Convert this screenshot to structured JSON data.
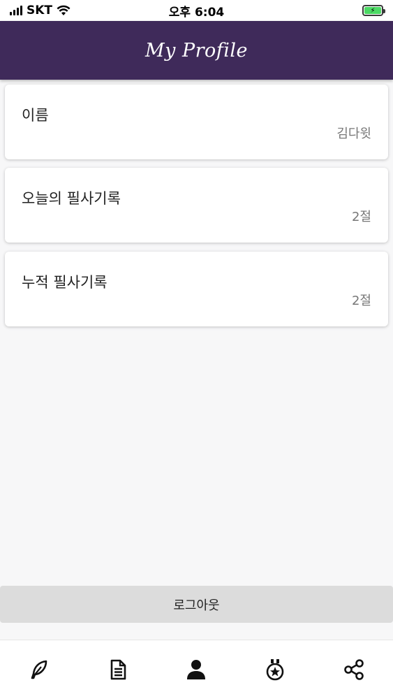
{
  "status_bar": {
    "carrier": "SKT",
    "time": "오후 6:04"
  },
  "header": {
    "title": "My Profile",
    "accent_color": "#3f2a5a"
  },
  "cards": [
    {
      "label": "이름",
      "value": "김다윗"
    },
    {
      "label": "오늘의 필사기록",
      "value": "2절"
    },
    {
      "label": "누적 필사기록",
      "value": "2절"
    }
  ],
  "logout": {
    "label": "로그아웃"
  },
  "bottom_nav": {
    "items": [
      {
        "icon": "quill-icon"
      },
      {
        "icon": "document-icon"
      },
      {
        "icon": "person-icon"
      },
      {
        "icon": "medal-icon"
      },
      {
        "icon": "share-icon"
      }
    ]
  }
}
